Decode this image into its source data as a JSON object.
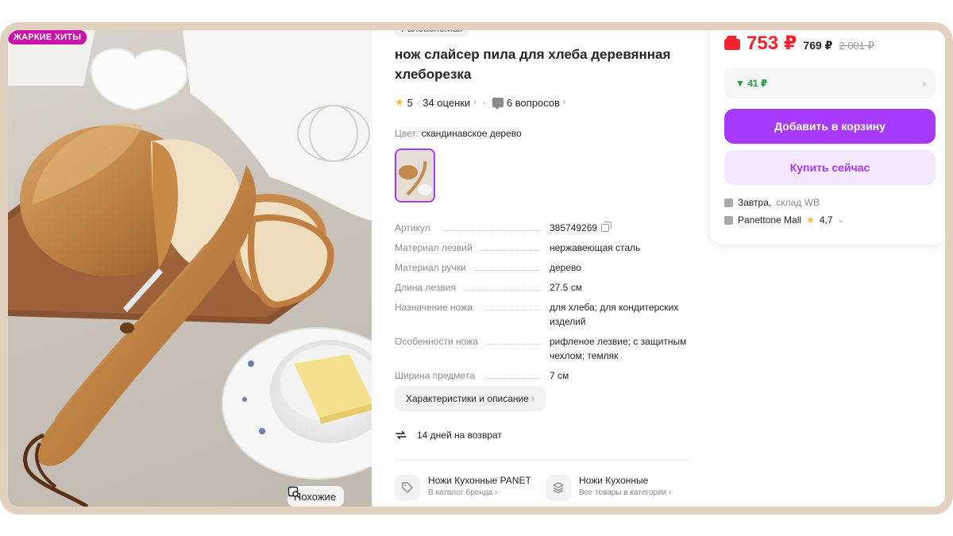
{
  "photo": {
    "badge": "ЖАРКИЕ ХИТЫ",
    "similar_label": "Похожие"
  },
  "product": {
    "brand_chip": "PanettoneMall",
    "title_line1": "нож слайсер пила для хлеба деревянная",
    "title_line2": "хлеборезка",
    "rating": "5",
    "reviews": "34 оценки",
    "questions": "6 вопросов",
    "color_label": "Цвет:",
    "color_value": "скандинавское дерево"
  },
  "specs": [
    {
      "key": "Артикул",
      "value": "385749269"
    },
    {
      "key": "Материал лезвий",
      "value": "нержавеющая сталь"
    },
    {
      "key": "Материал ручки",
      "value": "дерево"
    },
    {
      "key": "Длина лезвия",
      "value": "27.5 см"
    },
    {
      "key": "Назначение ножа",
      "value": "для хлеба; для кондитерских изделий"
    },
    {
      "key": "Особенности ножа",
      "value": "рифленое лезвие; с защитным чехлом; темляк"
    },
    {
      "key": "Ширина предмета",
      "value": "7 см"
    }
  ],
  "actions": {
    "characteristics": "Характеристики и описание",
    "return_policy": "14 дней на возврат"
  },
  "categories": [
    {
      "title": "Ножи Кухонные PANET",
      "subtitle": "В каталог бренда"
    },
    {
      "title": "Ножи Кухонные",
      "subtitle": "Все товары в категории"
    }
  ],
  "price": {
    "current": "753 ₽",
    "old1": "769 ₽",
    "old2": "2 001 ₽",
    "cashback": "▼ 41 ₽",
    "add_to_cart": "Добавить в корзину",
    "buy_now": "Купить сейчас",
    "delivery": "Завтра,",
    "warehouse": "склад WB",
    "seller_name": "Panettone Mall",
    "seller_rating": "4,7"
  },
  "colors": {
    "accent": "#a73afd",
    "price_red": "#f5222d",
    "badge": "#cb11ab",
    "cashback_green": "#21a038"
  }
}
